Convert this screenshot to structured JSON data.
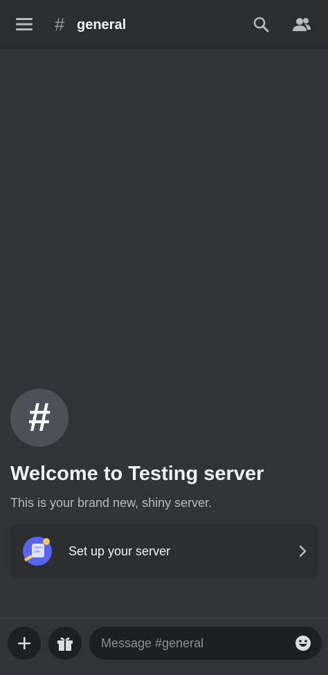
{
  "header": {
    "channel_prefix": "#",
    "channel_name": "general",
    "icons": {
      "menu": "menu-icon",
      "search": "search-icon",
      "members": "members-icon"
    }
  },
  "welcome": {
    "avatar_glyph": "#",
    "title": "Welcome to Testing server",
    "subtitle": "This is your brand new, shiny server."
  },
  "setup_card": {
    "label": "Set up your server",
    "icon": "server-setup-icon",
    "chevron": "chevron-right-icon"
  },
  "composer": {
    "placeholder": "Message #general",
    "icons": {
      "plus": "plus-icon",
      "gift": "gift-icon",
      "emoji": "emoji-icon"
    }
  },
  "colors": {
    "background": "#313338",
    "header_bg": "#2b2d31",
    "card_bg": "#2b2d31",
    "input_bg": "#1e1f22",
    "muted_text": "#b5bac1"
  }
}
